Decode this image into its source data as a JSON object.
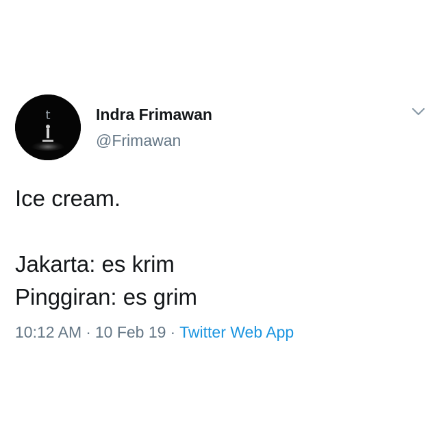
{
  "tweet": {
    "author": {
      "display_name": "Indra Frimawan",
      "handle": "@Frimawan",
      "avatar_letter": "t"
    },
    "body_lines": [
      "Ice cream.",
      "",
      "Jakarta: es krim",
      "Pinggiran: es grim"
    ],
    "time": "10:12 AM",
    "separator": "·",
    "date": "10 Feb 19",
    "source": "Twitter Web App",
    "menu_icon": "chevron-down-icon"
  },
  "colors": {
    "text_primary": "#14171a",
    "text_secondary": "#657786",
    "link": "#1b95e0",
    "background": "#ffffff"
  }
}
